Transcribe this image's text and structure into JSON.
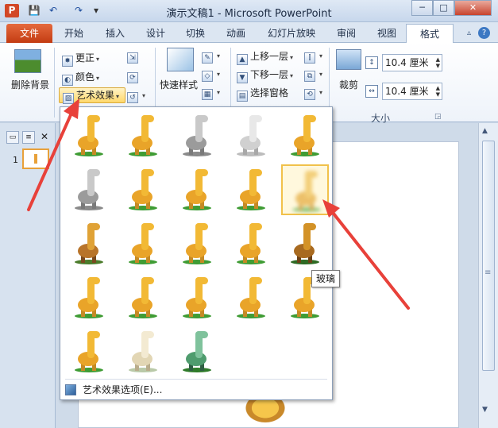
{
  "window": {
    "title": "演示文稿1 - Microsoft PowerPoint",
    "min": "─",
    "max": "□",
    "close": "✕"
  },
  "quick_access": {
    "logo": "P",
    "save": "💾",
    "undo": "↶",
    "redo": "↷",
    "more": "▾"
  },
  "tabs": [
    {
      "label": "文件"
    },
    {
      "label": "开始"
    },
    {
      "label": "插入"
    },
    {
      "label": "设计"
    },
    {
      "label": "切换"
    },
    {
      "label": "动画"
    },
    {
      "label": "幻灯片放映"
    },
    {
      "label": "审阅"
    },
    {
      "label": "视图"
    },
    {
      "label": "格式"
    }
  ],
  "ribbon": {
    "remove_background": "删除背景",
    "corrections": "更正",
    "color": "颜色",
    "artistic_effects": "艺术效果",
    "quick_styles": "快速样式",
    "bring_forward": "上移一层",
    "send_backward": "下移一层",
    "selection_pane": "选择窗格",
    "crop": "裁剪",
    "height": "10.4 厘米",
    "width": "10.4 厘米",
    "size_group": "大小"
  },
  "slides_panel": {
    "slide_number": "1"
  },
  "gallery": {
    "more_options": "艺术效果选项(E)...",
    "tooltip": "玻璃",
    "selected_index": 9,
    "effects": [
      "orange",
      "orange",
      "gray",
      "sketch",
      "orange",
      "gray",
      "orange",
      "orange",
      "orange",
      "blur",
      "mosaic",
      "orange",
      "orange",
      "orange",
      "dark",
      "orange",
      "orange",
      "orange",
      "orange",
      "orange",
      "orange",
      "pale",
      "teal"
    ]
  },
  "colors": {
    "accent": "#f1c14a",
    "arrow": "#e8413a",
    "file_tab": "#d24726"
  }
}
